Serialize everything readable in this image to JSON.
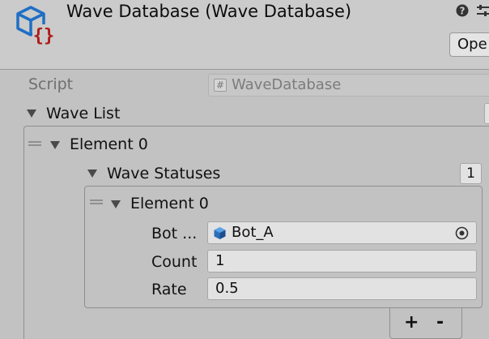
{
  "header": {
    "title": "Wave Database (Wave Database)",
    "open_button": "Ope",
    "icons": [
      "scriptable-object-icon",
      "help-icon",
      "preset-icon"
    ]
  },
  "script_field": {
    "label": "Script",
    "value": "WaveDatabase"
  },
  "wave_list": {
    "label": "Wave List",
    "elements": [
      {
        "label": "Element 0",
        "wave_statuses": {
          "label": "Wave Statuses",
          "count": "1",
          "elements": [
            {
              "label": "Element 0",
              "fields": [
                {
                  "label": "Bot ...",
                  "value": "Bot_A"
                },
                {
                  "label": "Count",
                  "value": "1"
                },
                {
                  "label": "Rate",
                  "value": "0.5"
                }
              ]
            }
          ],
          "add_label": "+",
          "remove_label": "-"
        }
      }
    ]
  },
  "colors": {
    "background": "#c2c2c2",
    "field_bg": "#e2e2e2",
    "icon_blue": "#1f6fc4",
    "icon_red": "#b01b1b"
  }
}
